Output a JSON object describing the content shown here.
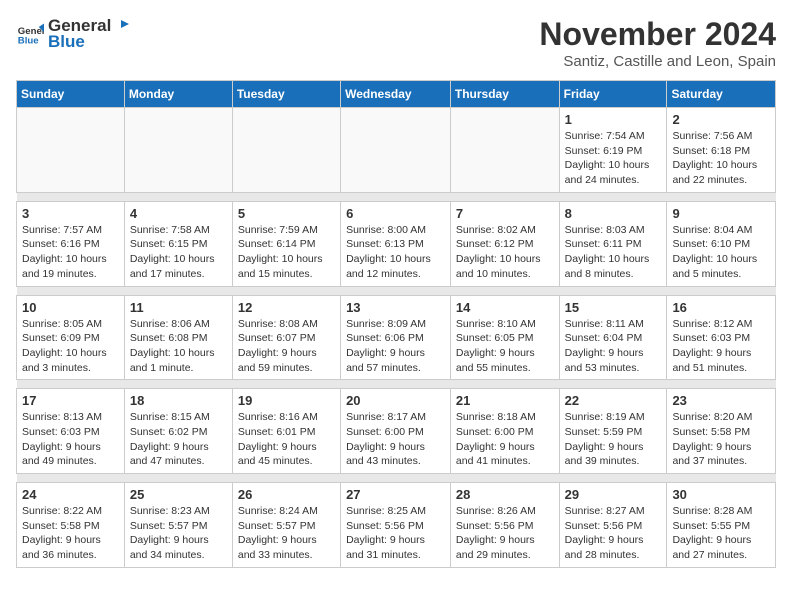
{
  "header": {
    "logo_general": "General",
    "logo_blue": "Blue",
    "month_year": "November 2024",
    "location": "Santiz, Castille and Leon, Spain"
  },
  "weekdays": [
    "Sunday",
    "Monday",
    "Tuesday",
    "Wednesday",
    "Thursday",
    "Friday",
    "Saturday"
  ],
  "weeks": [
    [
      {
        "day": "",
        "info": ""
      },
      {
        "day": "",
        "info": ""
      },
      {
        "day": "",
        "info": ""
      },
      {
        "day": "",
        "info": ""
      },
      {
        "day": "",
        "info": ""
      },
      {
        "day": "1",
        "info": "Sunrise: 7:54 AM\nSunset: 6:19 PM\nDaylight: 10 hours\nand 24 minutes."
      },
      {
        "day": "2",
        "info": "Sunrise: 7:56 AM\nSunset: 6:18 PM\nDaylight: 10 hours\nand 22 minutes."
      }
    ],
    [
      {
        "day": "3",
        "info": "Sunrise: 7:57 AM\nSunset: 6:16 PM\nDaylight: 10 hours\nand 19 minutes."
      },
      {
        "day": "4",
        "info": "Sunrise: 7:58 AM\nSunset: 6:15 PM\nDaylight: 10 hours\nand 17 minutes."
      },
      {
        "day": "5",
        "info": "Sunrise: 7:59 AM\nSunset: 6:14 PM\nDaylight: 10 hours\nand 15 minutes."
      },
      {
        "day": "6",
        "info": "Sunrise: 8:00 AM\nSunset: 6:13 PM\nDaylight: 10 hours\nand 12 minutes."
      },
      {
        "day": "7",
        "info": "Sunrise: 8:02 AM\nSunset: 6:12 PM\nDaylight: 10 hours\nand 10 minutes."
      },
      {
        "day": "8",
        "info": "Sunrise: 8:03 AM\nSunset: 6:11 PM\nDaylight: 10 hours\nand 8 minutes."
      },
      {
        "day": "9",
        "info": "Sunrise: 8:04 AM\nSunset: 6:10 PM\nDaylight: 10 hours\nand 5 minutes."
      }
    ],
    [
      {
        "day": "10",
        "info": "Sunrise: 8:05 AM\nSunset: 6:09 PM\nDaylight: 10 hours\nand 3 minutes."
      },
      {
        "day": "11",
        "info": "Sunrise: 8:06 AM\nSunset: 6:08 PM\nDaylight: 10 hours\nand 1 minute."
      },
      {
        "day": "12",
        "info": "Sunrise: 8:08 AM\nSunset: 6:07 PM\nDaylight: 9 hours\nand 59 minutes."
      },
      {
        "day": "13",
        "info": "Sunrise: 8:09 AM\nSunset: 6:06 PM\nDaylight: 9 hours\nand 57 minutes."
      },
      {
        "day": "14",
        "info": "Sunrise: 8:10 AM\nSunset: 6:05 PM\nDaylight: 9 hours\nand 55 minutes."
      },
      {
        "day": "15",
        "info": "Sunrise: 8:11 AM\nSunset: 6:04 PM\nDaylight: 9 hours\nand 53 minutes."
      },
      {
        "day": "16",
        "info": "Sunrise: 8:12 AM\nSunset: 6:03 PM\nDaylight: 9 hours\nand 51 minutes."
      }
    ],
    [
      {
        "day": "17",
        "info": "Sunrise: 8:13 AM\nSunset: 6:03 PM\nDaylight: 9 hours\nand 49 minutes."
      },
      {
        "day": "18",
        "info": "Sunrise: 8:15 AM\nSunset: 6:02 PM\nDaylight: 9 hours\nand 47 minutes."
      },
      {
        "day": "19",
        "info": "Sunrise: 8:16 AM\nSunset: 6:01 PM\nDaylight: 9 hours\nand 45 minutes."
      },
      {
        "day": "20",
        "info": "Sunrise: 8:17 AM\nSunset: 6:00 PM\nDaylight: 9 hours\nand 43 minutes."
      },
      {
        "day": "21",
        "info": "Sunrise: 8:18 AM\nSunset: 6:00 PM\nDaylight: 9 hours\nand 41 minutes."
      },
      {
        "day": "22",
        "info": "Sunrise: 8:19 AM\nSunset: 5:59 PM\nDaylight: 9 hours\nand 39 minutes."
      },
      {
        "day": "23",
        "info": "Sunrise: 8:20 AM\nSunset: 5:58 PM\nDaylight: 9 hours\nand 37 minutes."
      }
    ],
    [
      {
        "day": "24",
        "info": "Sunrise: 8:22 AM\nSunset: 5:58 PM\nDaylight: 9 hours\nand 36 minutes."
      },
      {
        "day": "25",
        "info": "Sunrise: 8:23 AM\nSunset: 5:57 PM\nDaylight: 9 hours\nand 34 minutes."
      },
      {
        "day": "26",
        "info": "Sunrise: 8:24 AM\nSunset: 5:57 PM\nDaylight: 9 hours\nand 33 minutes."
      },
      {
        "day": "27",
        "info": "Sunrise: 8:25 AM\nSunset: 5:56 PM\nDaylight: 9 hours\nand 31 minutes."
      },
      {
        "day": "28",
        "info": "Sunrise: 8:26 AM\nSunset: 5:56 PM\nDaylight: 9 hours\nand 29 minutes."
      },
      {
        "day": "29",
        "info": "Sunrise: 8:27 AM\nSunset: 5:56 PM\nDaylight: 9 hours\nand 28 minutes."
      },
      {
        "day": "30",
        "info": "Sunrise: 8:28 AM\nSunset: 5:55 PM\nDaylight: 9 hours\nand 27 minutes."
      }
    ]
  ]
}
